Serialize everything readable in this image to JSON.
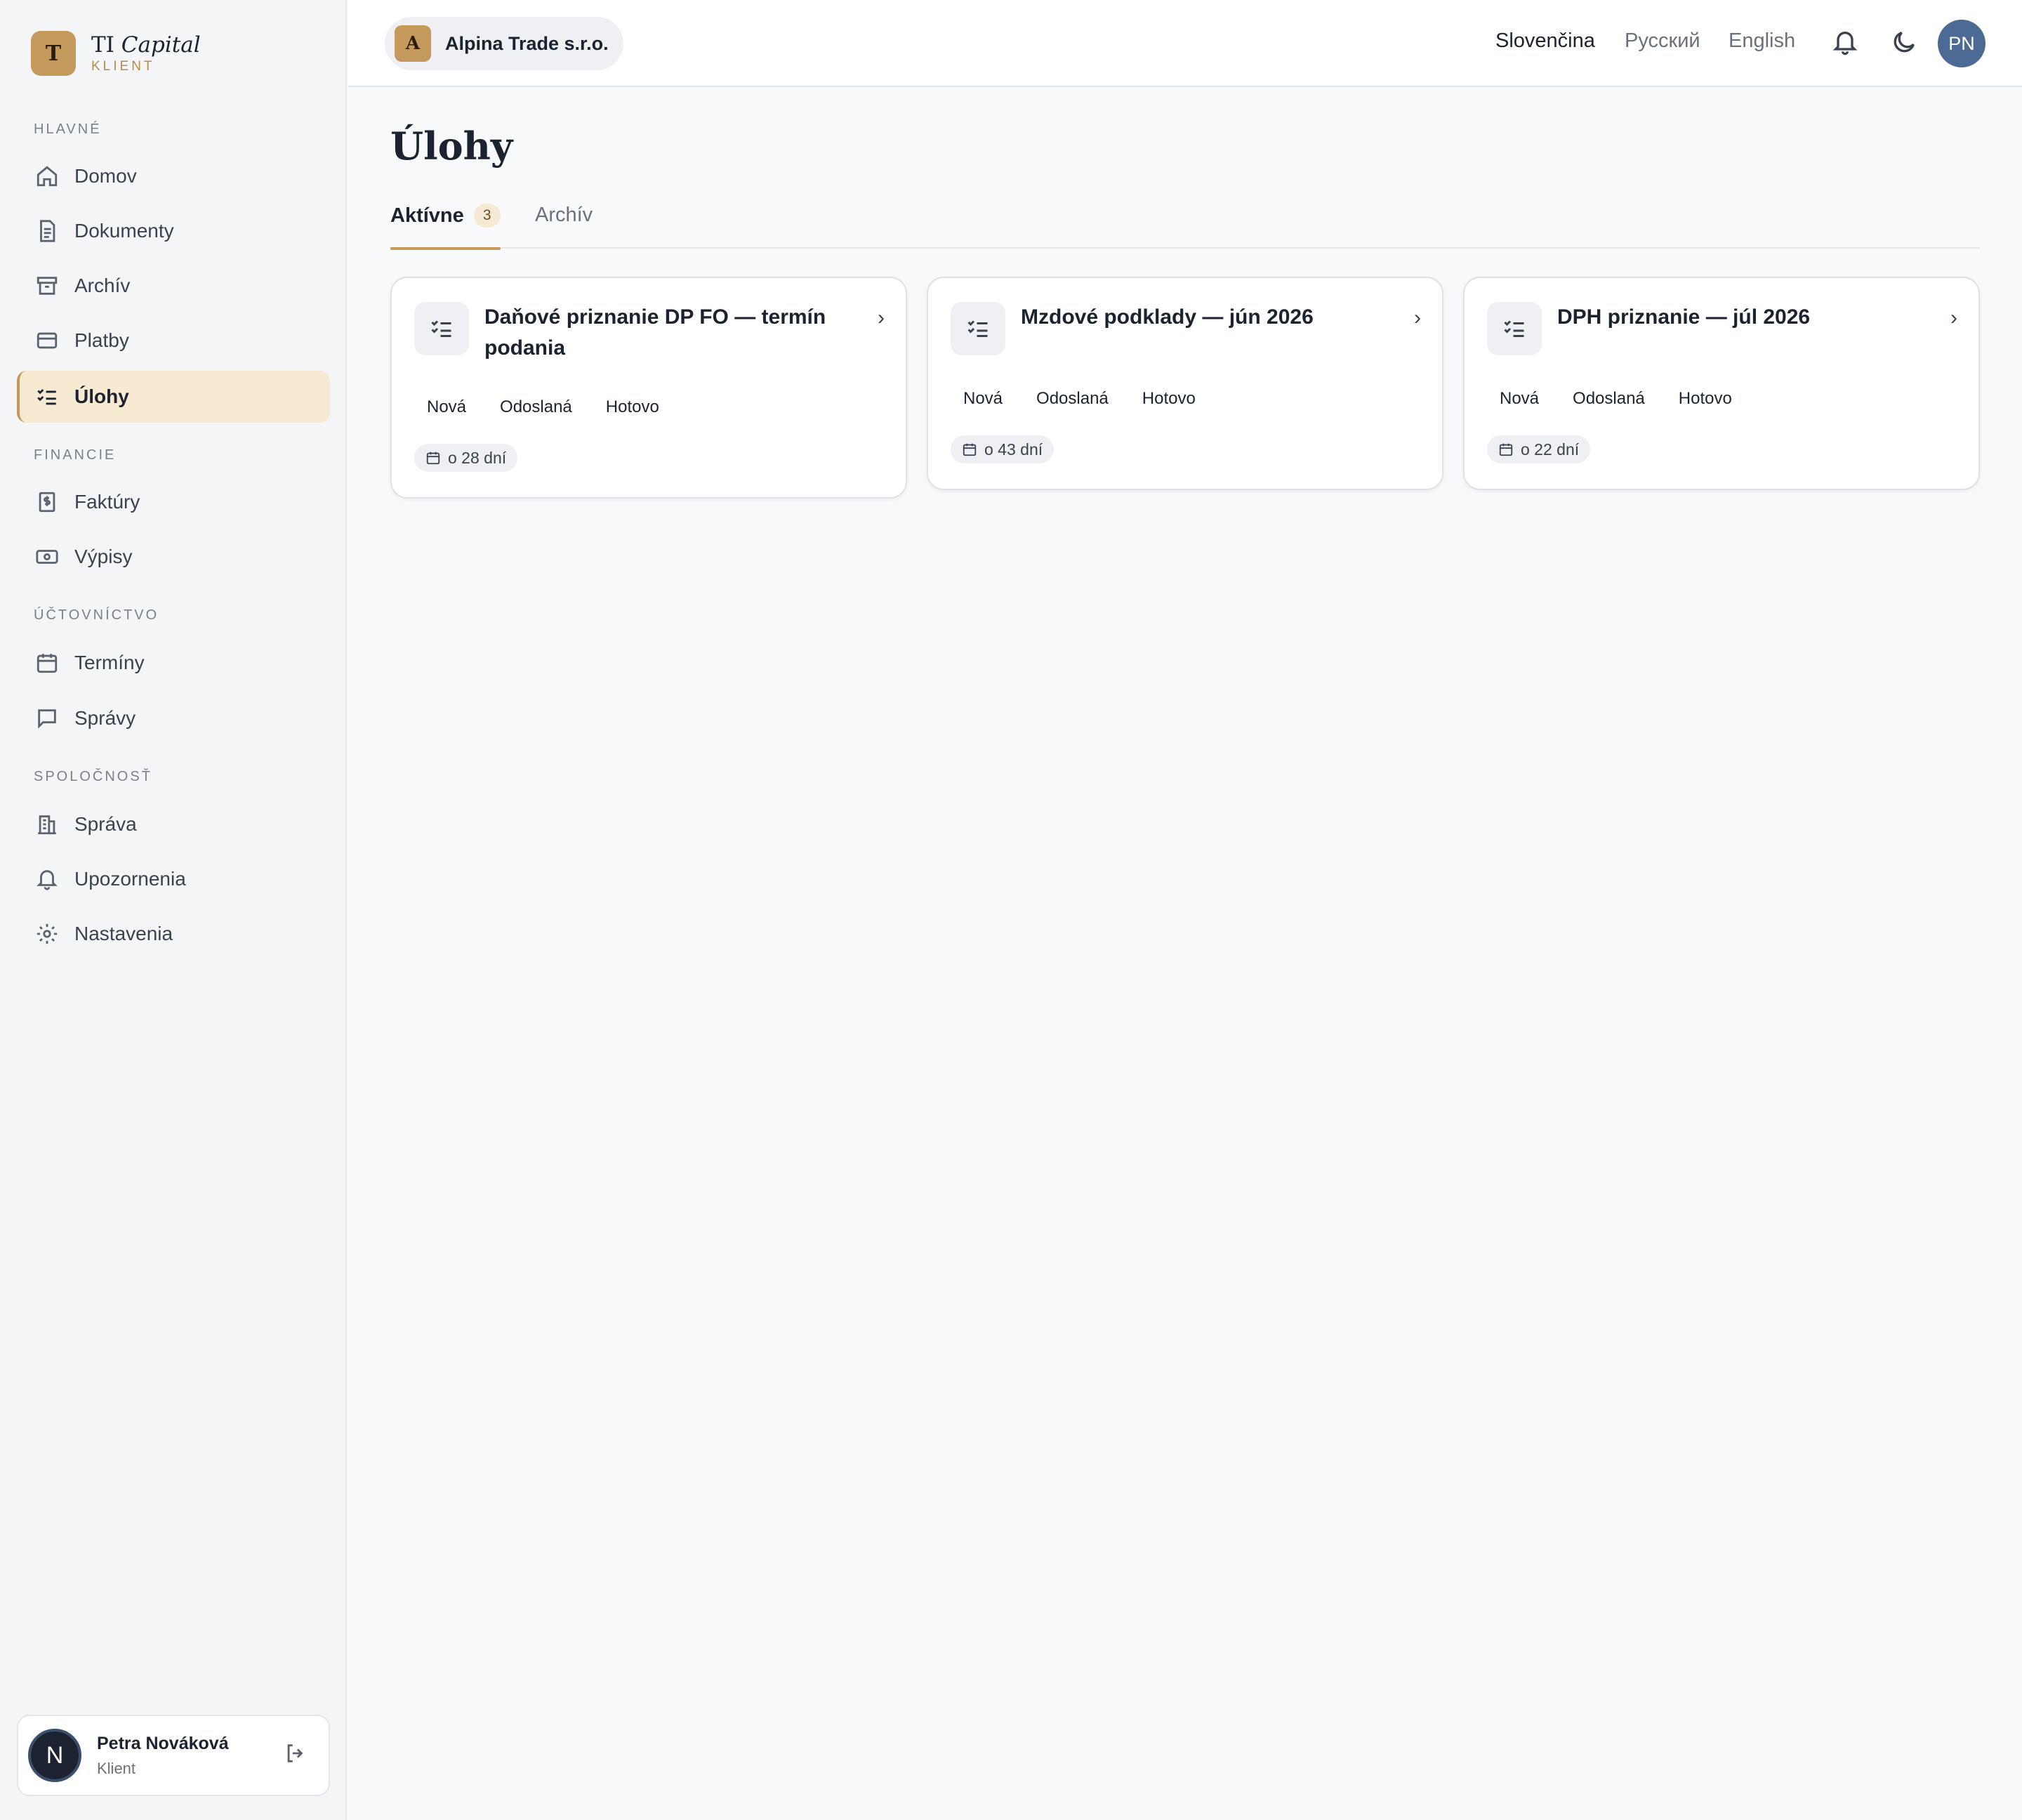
{
  "brand": {
    "mark": "T",
    "name_plain": "TI",
    "name_italic": "Capital",
    "subtitle": "KLIENT"
  },
  "sidebar": {
    "sections": [
      {
        "label": "HLAVNÉ",
        "items": [
          {
            "label": "Domov",
            "icon": "home-icon"
          },
          {
            "label": "Dokumenty",
            "icon": "document-icon"
          },
          {
            "label": "Archív",
            "icon": "archive-icon"
          },
          {
            "label": "Platby",
            "icon": "card-icon"
          },
          {
            "label": "Úlohy",
            "icon": "checklist-icon",
            "active": true
          }
        ]
      },
      {
        "label": "FINANCIE",
        "items": [
          {
            "label": "Faktúry",
            "icon": "invoice-icon"
          },
          {
            "label": "Výpisy",
            "icon": "banknote-icon"
          }
        ]
      },
      {
        "label": "ÚČTOVNÍCTVO",
        "items": [
          {
            "label": "Termíny",
            "icon": "calendar-icon"
          },
          {
            "label": "Správy",
            "icon": "message-icon"
          }
        ]
      },
      {
        "label": "SPOLOČNOSŤ",
        "items": [
          {
            "label": "Správa",
            "icon": "building-icon"
          },
          {
            "label": "Upozornenia",
            "icon": "bell-icon"
          },
          {
            "label": "Nastavenia",
            "icon": "gear-icon"
          }
        ]
      }
    ],
    "user": {
      "initial": "N",
      "name": "Petra Nováková",
      "role": "Klient"
    }
  },
  "header": {
    "company": {
      "mark": "A",
      "name": "Alpina Trade s.r.o."
    },
    "languages": [
      "Slovenčina",
      "Русский",
      "English"
    ],
    "active_language": "Slovenčina",
    "avatar": "PN"
  },
  "main": {
    "title": "Úlohy",
    "tabs": [
      {
        "label": "Aktívne",
        "badge": "3",
        "active": true
      },
      {
        "label": "Archív"
      }
    ],
    "tasks": [
      {
        "title": "Daňové priznanie DP FO — termín podania",
        "steps": [
          "Nová",
          "Odoslaná",
          "Hotovo"
        ],
        "due": "o 28 dní"
      },
      {
        "title": "Mzdové podklady — jún 2026",
        "steps": [
          "Nová",
          "Odoslaná",
          "Hotovo"
        ],
        "due": "o 43 dní"
      },
      {
        "title": "DPH priznanie — júl 2026",
        "steps": [
          "Nová",
          "Odoslaná",
          "Hotovo"
        ],
        "due": "o 22 dní"
      }
    ]
  },
  "colors": {
    "accent": "#c49a5c",
    "active_bg": "#f6ead2",
    "avatar_bg": "#4b6a94"
  }
}
